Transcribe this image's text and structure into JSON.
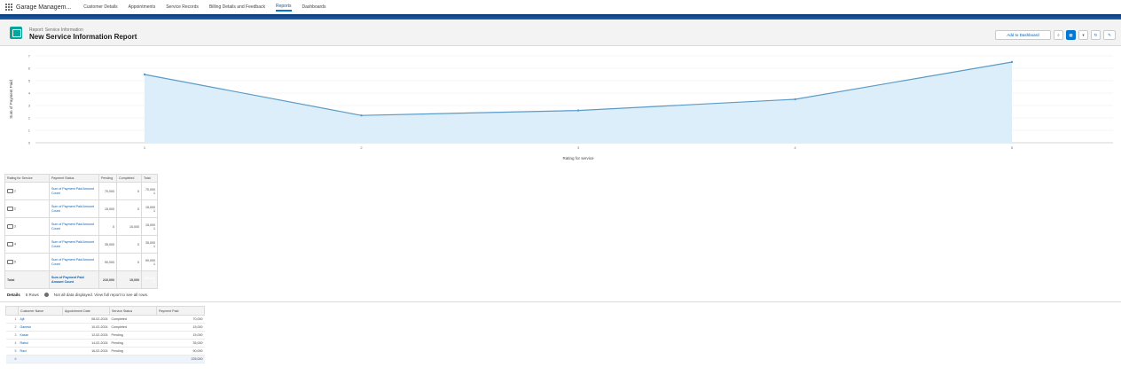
{
  "nav": {
    "app_name": "Garage Managem...",
    "tabs": [
      {
        "label": "Customer Details",
        "active": false
      },
      {
        "label": "Appointments",
        "active": false
      },
      {
        "label": "Service Records",
        "active": false
      },
      {
        "label": "Billing Details and Feedback",
        "active": false
      },
      {
        "label": "Reports",
        "active": true
      },
      {
        "label": "Dashboards",
        "active": false
      }
    ]
  },
  "header": {
    "subtitle": "Report: Service Information",
    "title": "New Service Information Report",
    "add_chart_label": "Add to Dashboard"
  },
  "chart_data": {
    "type": "area",
    "title": "",
    "xlabel": "Rating for service",
    "ylabel": "Sum of Payment Paid",
    "categories": [
      "1",
      "2",
      "3",
      "4",
      "5"
    ],
    "values": [
      5.5,
      2.2,
      2.6,
      3.5,
      6.5
    ],
    "ylim": [
      0,
      7
    ],
    "yticks": [
      "0",
      "1",
      "2",
      "3",
      "4",
      "5",
      "6",
      "7"
    ],
    "color": "#5b9bc8",
    "fill": "#dbeefa",
    "grid": true
  },
  "summary_table": {
    "headers": [
      "Rating for Service",
      "Payment Status",
      "Pending",
      "Completed",
      "Total"
    ],
    "rows": [
      {
        "group": "1",
        "status": "Sum of Payment Paid Amount Count",
        "pending": "70,000",
        "completed": "0",
        "total": "70,000",
        "count": "1"
      },
      {
        "group": "2",
        "status": "Sum of Payment Paid Amount Count",
        "pending": "15,000",
        "completed": "0",
        "total": "15,000",
        "count": "1"
      },
      {
        "group": "3",
        "status": "Sum of Payment Paid Amount Count",
        "pending": "0",
        "completed": "15,000",
        "total": "15,000",
        "count": "1"
      },
      {
        "group": "4",
        "status": "Sum of Payment Paid Amount Count",
        "pending": "35,000",
        "completed": "0",
        "total": "35,000",
        "count": "1"
      },
      {
        "group": "5",
        "status": "Sum of Payment Paid Amount Count",
        "pending": "90,000",
        "completed": "0",
        "total": "90,000",
        "count": "1"
      }
    ],
    "total_row": {
      "group": "Total",
      "status": "Sum of Payment Paid Amount Count",
      "pending": "210,000",
      "completed": "15,000",
      "total": "225,000",
      "count": "5"
    }
  },
  "details": {
    "label": "Details",
    "rows_text": "5 Rows",
    "info_text": "Not all data displayed. View full report to see all rows."
  },
  "detail_table": {
    "headers": [
      "Customer Name",
      "Appointment Date",
      "Service Status",
      "Payment Paid"
    ],
    "rows": [
      {
        "idx": "1",
        "name": "Ajit",
        "date": "08-02-2024",
        "status": "Completed",
        "paid": "70,000"
      },
      {
        "idx": "2",
        "name": "Ganesh",
        "date": "10-02-2024",
        "status": "Completed",
        "paid": "15,000"
      },
      {
        "idx": "3",
        "name": "Karan",
        "date": "12-02-2024",
        "status": "Pending",
        "paid": "15,000"
      },
      {
        "idx": "4",
        "name": "Rahul",
        "date": "14-02-2024",
        "status": "Pending",
        "paid": "35,000"
      },
      {
        "idx": "5",
        "name": "Ravi",
        "date": "16-02-2024",
        "status": "Pending",
        "paid": "90,000"
      }
    ],
    "sum_row": {
      "idx": "6",
      "paid": "225,000"
    }
  }
}
